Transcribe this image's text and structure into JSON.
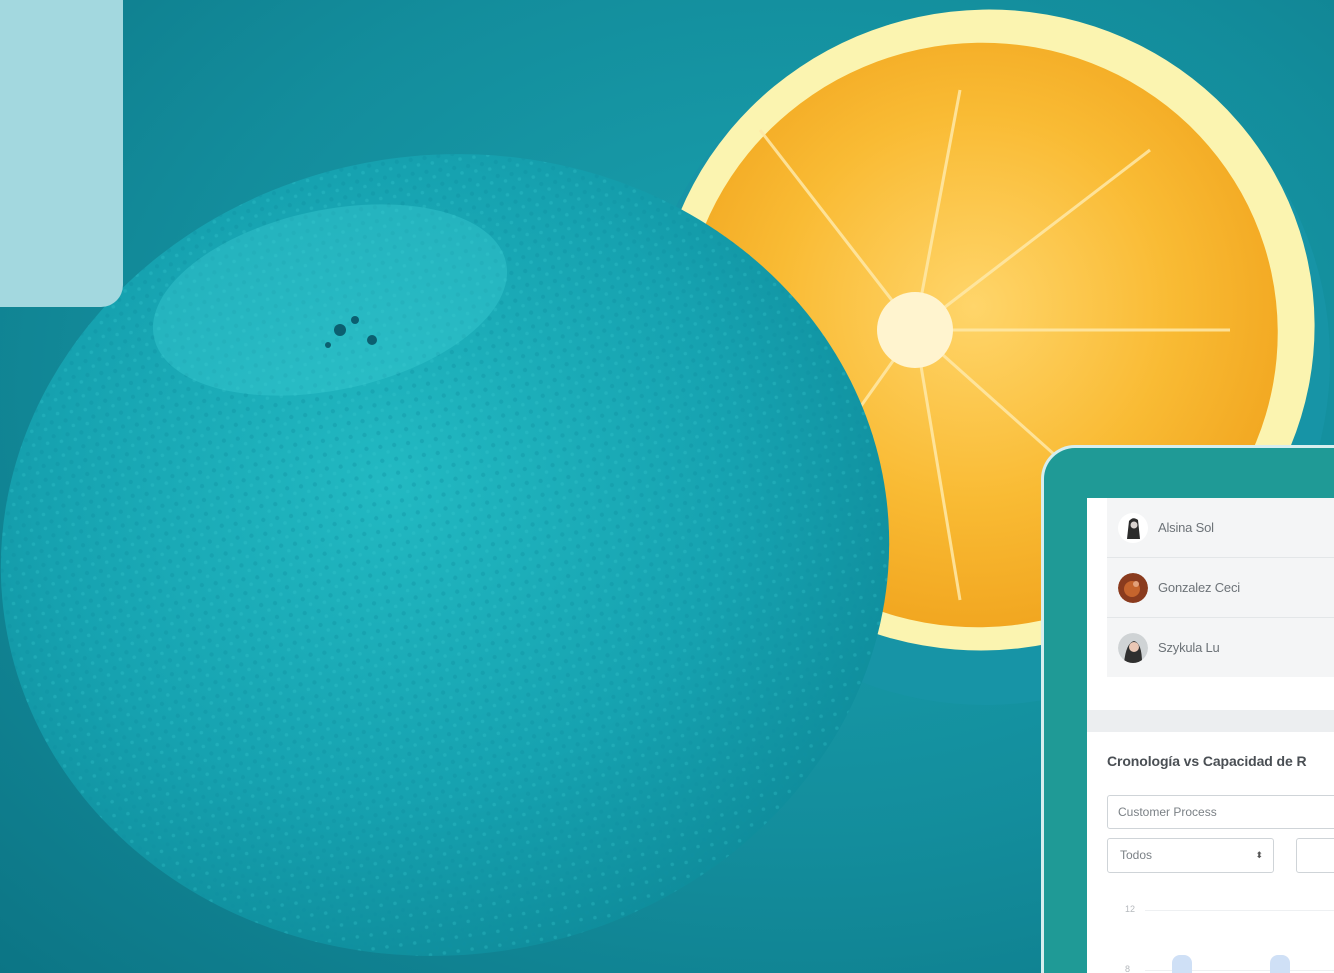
{
  "users": [
    {
      "name": "Alsina Sol",
      "avatar_icon": "user-avatar-photo"
    },
    {
      "name": "Gonzalez Ceci",
      "avatar_icon": "user-avatar-photo"
    },
    {
      "name": "Szykula Lu",
      "avatar_icon": "user-avatar-photo"
    }
  ],
  "section": {
    "title": "Cronología vs Capacidad de R"
  },
  "filters": {
    "process_value": "Customer Process",
    "scope_select": "Todos",
    "select_arrow": "⬍"
  },
  "chart": {
    "y_ticks": [
      "12",
      "8"
    ]
  },
  "colors": {
    "background_teal": "#138d9c",
    "device_frame": "#1f9a96",
    "corner_card": "#a3d8df",
    "orange_flesh": "#f7b22a"
  }
}
